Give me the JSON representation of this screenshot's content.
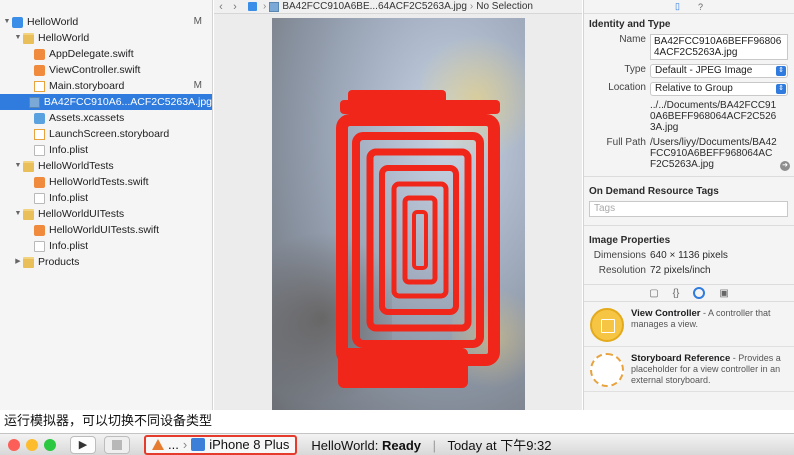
{
  "navigator": {
    "items": [
      {
        "label": "HelloWorld",
        "badge": "M",
        "kind": "project",
        "indent": 0,
        "disclosure": "▼"
      },
      {
        "label": "HelloWorld",
        "badge": "",
        "kind": "folder",
        "indent": 1,
        "disclosure": "▼"
      },
      {
        "label": "AppDelegate.swift",
        "badge": "",
        "kind": "swift",
        "indent": 2,
        "disclosure": ""
      },
      {
        "label": "ViewController.swift",
        "badge": "",
        "kind": "swift",
        "indent": 2,
        "disclosure": ""
      },
      {
        "label": "Main.storyboard",
        "badge": "M",
        "kind": "storyboard",
        "indent": 2,
        "disclosure": ""
      },
      {
        "label": "BA42FCC910A6...ACF2C5263A.jpg",
        "badge": "",
        "kind": "image",
        "indent": 2,
        "disclosure": "",
        "selected": true
      },
      {
        "label": "Assets.xcassets",
        "badge": "",
        "kind": "assets",
        "indent": 2,
        "disclosure": ""
      },
      {
        "label": "LaunchScreen.storyboard",
        "badge": "",
        "kind": "storyboard",
        "indent": 2,
        "disclosure": ""
      },
      {
        "label": "Info.plist",
        "badge": "",
        "kind": "file",
        "indent": 2,
        "disclosure": ""
      },
      {
        "label": "HelloWorldTests",
        "badge": "",
        "kind": "folder",
        "indent": 1,
        "disclosure": "▼"
      },
      {
        "label": "HelloWorldTests.swift",
        "badge": "",
        "kind": "swift",
        "indent": 2,
        "disclosure": ""
      },
      {
        "label": "Info.plist",
        "badge": "",
        "kind": "file",
        "indent": 2,
        "disclosure": ""
      },
      {
        "label": "HelloWorldUITests",
        "badge": "",
        "kind": "folder",
        "indent": 1,
        "disclosure": "▼"
      },
      {
        "label": "HelloWorldUITests.swift",
        "badge": "",
        "kind": "swift",
        "indent": 2,
        "disclosure": ""
      },
      {
        "label": "Info.plist",
        "badge": "",
        "kind": "file",
        "indent": 2,
        "disclosure": ""
      },
      {
        "label": "Products",
        "badge": "",
        "kind": "folder",
        "indent": 1,
        "disclosure": "▶"
      }
    ]
  },
  "jumpbar": {
    "file": "BA42FCC910A6BE...64ACF2C5263A.jpg",
    "selection": "No Selection"
  },
  "inspector": {
    "identity_title": "Identity and Type",
    "name_label": "Name",
    "name_value": "BA42FCC910A6BEFF968064ACF2C5263A.jpg",
    "type_label": "Type",
    "type_value": "Default - JPEG Image",
    "location_label": "Location",
    "location_value": "Relative to Group",
    "location_path": "../../Documents/BA42FCC910A6BEFF968064ACF2C5263A.jpg",
    "fullpath_label": "Full Path",
    "fullpath_value": "/Users/liyy/Documents/BA42FCC910A6BEFF968064ACF2C5263A.jpg",
    "odr_title": "On Demand Resource Tags",
    "tags_placeholder": "Tags",
    "image_props_title": "Image Properties",
    "dimensions_label": "Dimensions",
    "dimensions_value": "640 × 1136 pixels",
    "resolution_label": "Resolution",
    "resolution_value": "72 pixels/inch"
  },
  "library": {
    "items": [
      {
        "title": "View Controller",
        "desc": " - A controller that manages a view.",
        "icon": "view-controller-icon"
      },
      {
        "title": "Storyboard Reference",
        "desc": " - Provides a placeholder for a view controller in an external storyboard.",
        "icon": "storyboard-reference-icon"
      }
    ]
  },
  "caption": "运行模拟器，可以切换不同设备类型",
  "toolbar": {
    "scheme_ellipsis": "...",
    "device": "iPhone 8 Plus",
    "status_app": "HelloWorld:",
    "status_state": "Ready",
    "status_time": "Today at 下午9:32"
  },
  "colors": {
    "accent": "#2f7bde",
    "overlay_red": "#f0261b",
    "highlight_border": "#e53b2c"
  }
}
